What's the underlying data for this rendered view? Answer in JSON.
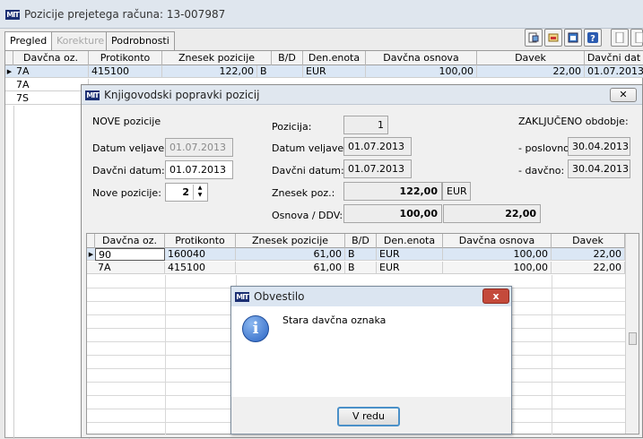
{
  "main": {
    "title": "Pozicije prejetega računa: 13-007987",
    "tabs": [
      {
        "label": "Pregled",
        "active": true
      },
      {
        "label": "Korekture",
        "disabled": true
      },
      {
        "label": "Podrobnosti"
      }
    ],
    "grid": {
      "columns": [
        "Davčna oz.",
        "Protikonto",
        "Znesek pozicije",
        "B/D",
        "Den.enota",
        "Davčna osnova",
        "Davek",
        "Davčni dat"
      ],
      "rows": [
        [
          "7A",
          "415100",
          "122,00",
          "B",
          "EUR",
          "100,00",
          "22,00",
          "01.07.2013"
        ],
        [
          "7A",
          "",
          "",
          "",
          "",
          "",
          "",
          ""
        ],
        [
          "7S",
          "",
          "",
          "",
          "",
          "",
          "",
          ""
        ]
      ]
    },
    "toolbar_icons": [
      "report-icon",
      "export-icon",
      "window-icon",
      "help-icon",
      "page-icon",
      "page-icon"
    ]
  },
  "dialog": {
    "title": "Knjigovodski popravki pozicij",
    "nove_pozicije_heading": "NOVE pozicije",
    "datum_veljave_label": "Datum veljave:",
    "datum_veljave_value": "01.07.2013",
    "davcni_datum_label": "Davčni datum:",
    "davcni_datum_value": "01.07.2013",
    "nove_pozicije_label": "Nove pozicije:",
    "nove_pozicije_value": "2",
    "pozicija_label": "Pozicija:",
    "pozicija_value": "1",
    "datum_veljave2_label": "Datum veljave:",
    "datum_veljave2_value": "01.07.2013",
    "davcni_datum2_label": "Davčni datum:",
    "davcni_datum2_value": "01.07.2013",
    "znesek_label": "Znesek poz.:",
    "znesek_value": "122,00",
    "currency": "EUR",
    "osnova_label": "Osnova / DDV:",
    "osnova_value": "100,00",
    "ddv_value": "22,00",
    "zakljuceno_heading": "ZAKLJUČENO obdobje:",
    "poslovno_label": "- poslovno:",
    "poslovno_value": "30.04.2013",
    "davcno_label": "- davčno:",
    "davcno_value": "30.04.2013",
    "grid": {
      "columns": [
        "Davčna oz.",
        "Protikonto",
        "Znesek pozicije",
        "B/D",
        "Den.enota",
        "Davčna osnova",
        "Davek"
      ],
      "rows": [
        [
          "90",
          "160040",
          "61,00",
          "B",
          "EUR",
          "100,00",
          "22,00"
        ],
        [
          "7A",
          "415100",
          "61,00",
          "B",
          "EUR",
          "100,00",
          "22,00"
        ]
      ]
    }
  },
  "message": {
    "title": "Obvestilo",
    "text": "Stara davčna oznaka",
    "ok_label": "V redu",
    "close_label": "x"
  }
}
